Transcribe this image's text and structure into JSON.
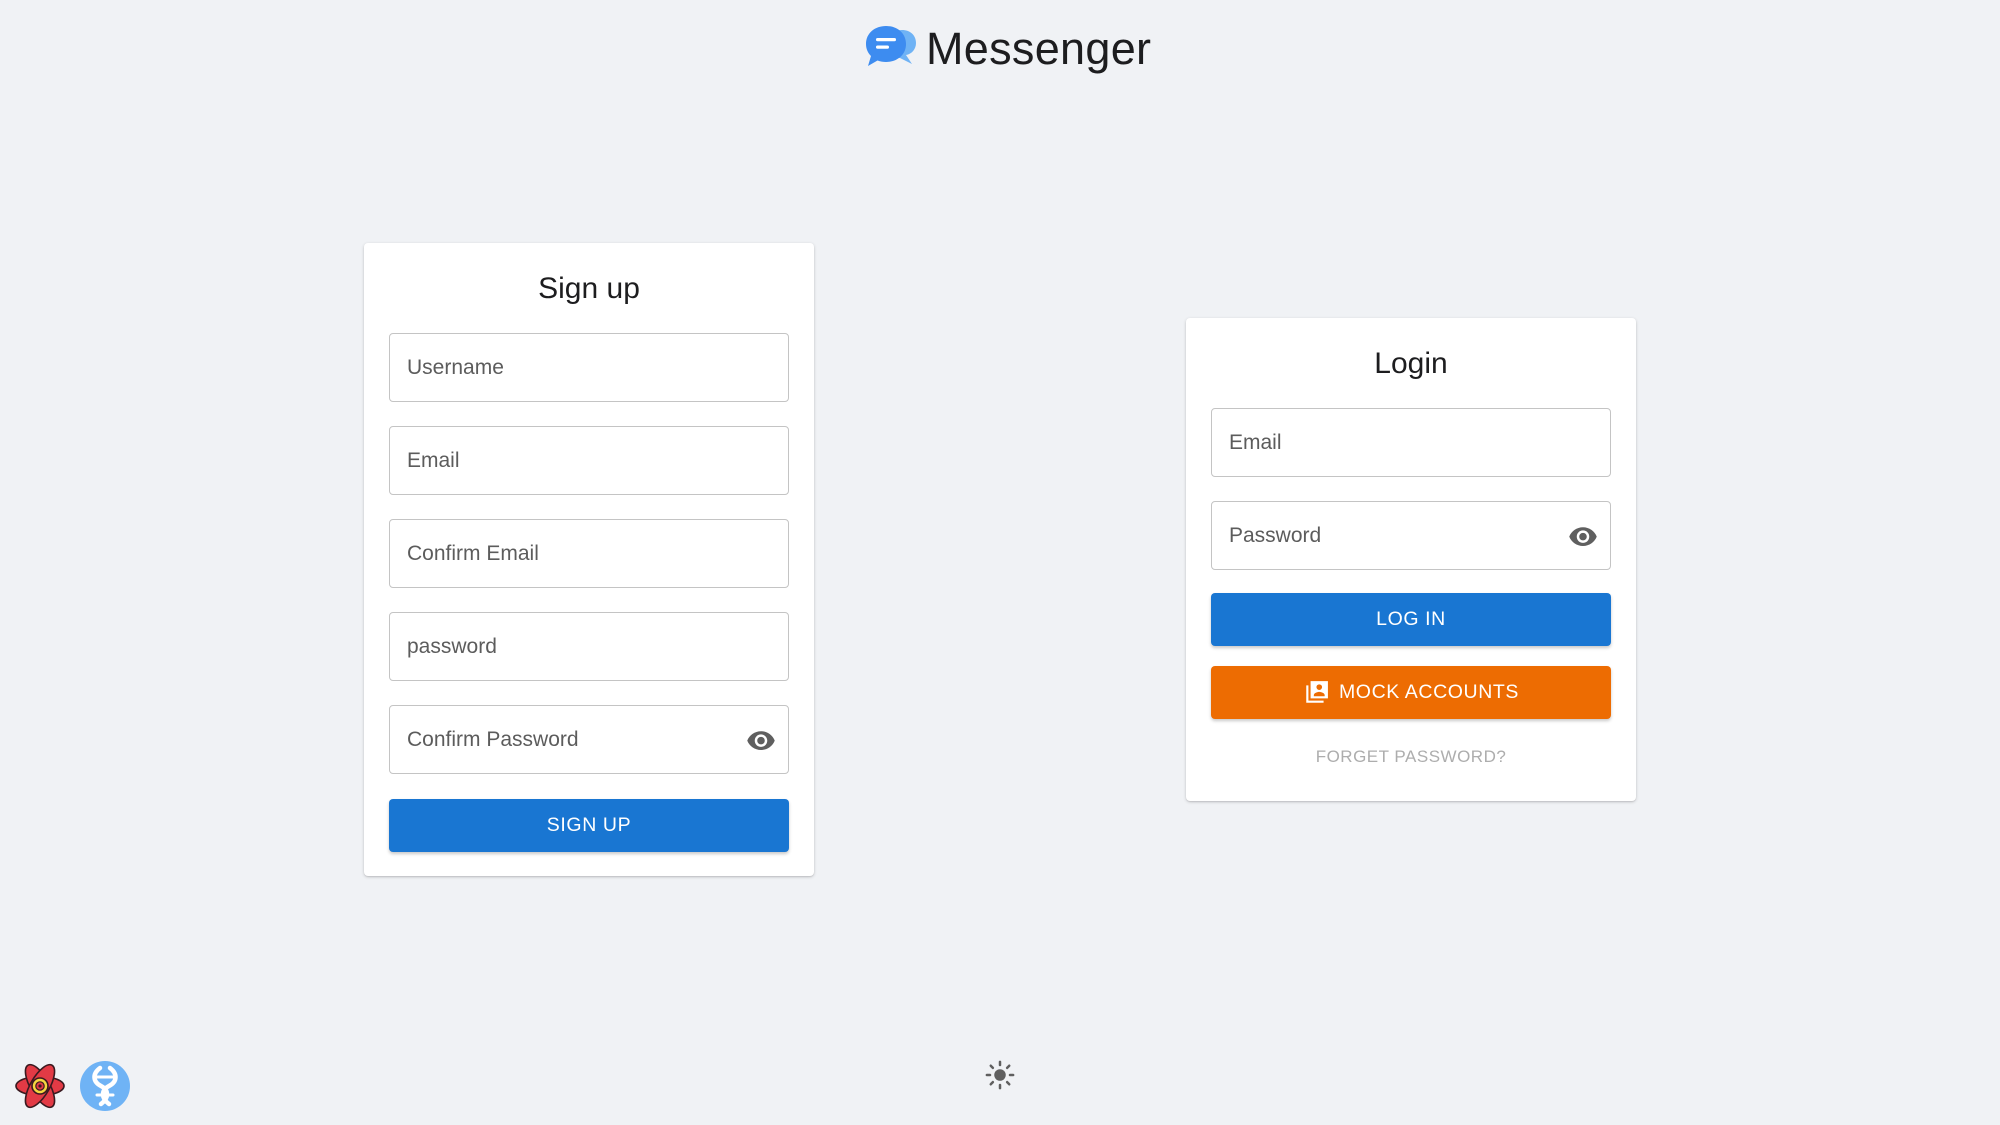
{
  "app": {
    "title": "Messenger",
    "logo_icon": "chat-bubbles-icon"
  },
  "signup": {
    "title": "Sign up",
    "fields": {
      "username": {
        "placeholder": "Username",
        "value": ""
      },
      "email": {
        "placeholder": "Email",
        "value": ""
      },
      "confirm_email": {
        "placeholder": "Confirm Email",
        "value": ""
      },
      "password": {
        "placeholder": "password",
        "value": ""
      },
      "confirm_password": {
        "placeholder": "Confirm Password",
        "value": ""
      }
    },
    "visibility_icon": "eye-icon",
    "submit_label": "SIGN UP"
  },
  "login": {
    "title": "Login",
    "fields": {
      "email": {
        "placeholder": "Email",
        "value": ""
      },
      "password": {
        "placeholder": "Password",
        "value": ""
      }
    },
    "visibility_icon": "eye-icon",
    "submit_label": "LOG IN",
    "mock_accounts_label": "MOCK ACCOUNTS",
    "mock_accounts_icon": "contacts-book-icon",
    "forgot_label": "FORGET PASSWORD?"
  },
  "footer": {
    "theme_toggle_icon": "sun-icon",
    "devtools": [
      "react-devtools-icon",
      "redux-devtools-icon"
    ]
  },
  "colors": {
    "background": "#f0f2f5",
    "primary": "#1976d2",
    "warning": "#ed6c02",
    "muted_text": "#adadad",
    "logo_blue": "#3d8cf0",
    "logo_light_blue": "#6fb3f5"
  }
}
